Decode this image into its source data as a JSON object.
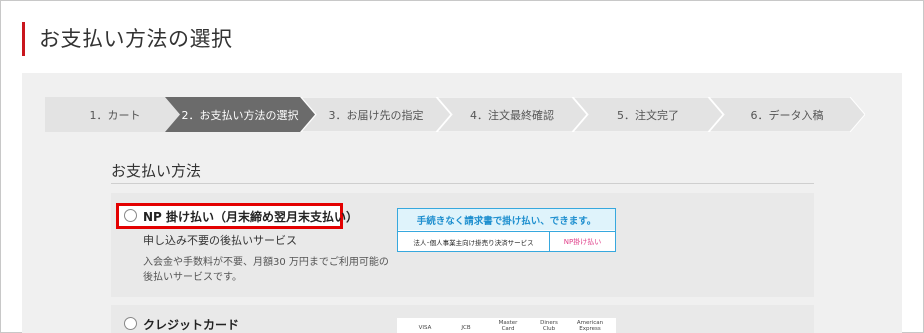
{
  "page": {
    "title": "お支払い方法の選択"
  },
  "steps": [
    {
      "label": "1．カート",
      "active": false
    },
    {
      "label": "2．お支払い方法の選択",
      "active": true
    },
    {
      "label": "3．お届け先の指定",
      "active": false
    },
    {
      "label": "4．注文最終確認",
      "active": false
    },
    {
      "label": "5．注文完了",
      "active": false
    },
    {
      "label": "6．データ入稿",
      "active": false
    }
  ],
  "payment": {
    "section_title": "お支払い方法",
    "options": [
      {
        "label": "NP 掛け払い（月末締め翌月末支払い）",
        "sub": "申し込み不要の後払いサービス",
        "desc_line1": "入会金や手数料が不要、月額30 万円までご利用可能の",
        "desc_line2": "後払いサービスです。",
        "banner_top": "手続きなく請求書で掛け払い、できます。",
        "banner_bottom_left": "法人･個人事業主向け掛売り決済サービス",
        "banner_bottom_right": "NP掛け払い"
      },
      {
        "label": "クレジットカード",
        "card_brands": [
          "VISA",
          "JCB",
          "Master Card",
          "Diners Club",
          "American Express"
        ]
      }
    ]
  },
  "colors": {
    "accent": "#c9161d",
    "highlight": "#e30000",
    "step_active": "#6b6b6b",
    "step_inactive": "#e3e3e3",
    "np_blue": "#37a8de"
  }
}
